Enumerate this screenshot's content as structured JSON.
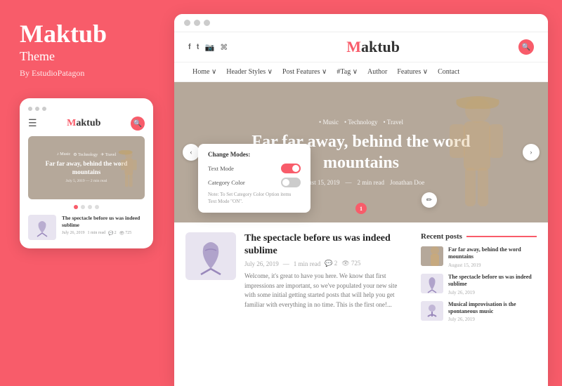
{
  "left": {
    "brand": "Maktub",
    "theme_label": "Theme",
    "by_label": "By EstudioPatagon",
    "mobile": {
      "brand": "Maktub",
      "hero_tags": [
        "Music",
        "Technology",
        "Travel"
      ],
      "hero_title": "Far far away, behind the word mountains",
      "hero_meta": "July 5, 2019  —  2 min read",
      "nav_dots": [
        "active",
        "",
        "",
        "",
        ""
      ],
      "post_title": "The spectacle before us was indeed sublime",
      "post_meta_date": "July 26, 2019",
      "post_meta_read": "1 min read",
      "post_meta_comments": "2",
      "post_meta_views": "725"
    }
  },
  "right": {
    "browser_circles": [
      "",
      "",
      ""
    ],
    "social_icons": [
      "f",
      "t",
      "in",
      "rss"
    ],
    "site_logo": "Maktub",
    "nav_items": [
      {
        "label": "Home",
        "has_chevron": true
      },
      {
        "label": "Header Styles",
        "has_chevron": true
      },
      {
        "label": "Post Features",
        "has_chevron": true
      },
      {
        "label": "#Tag",
        "has_chevron": true
      },
      {
        "label": "Author",
        "has_chevron": false
      },
      {
        "label": "Features",
        "has_chevron": true
      },
      {
        "label": "Contact",
        "has_chevron": false
      }
    ],
    "hero": {
      "tags": [
        "Music",
        "Technology",
        "Travel"
      ],
      "title": "Far far away, behind the word mountains",
      "date": "August 15, 2019",
      "read": "2 min read",
      "notify": "1",
      "author": "Jonathan Doe"
    },
    "change_modes": {
      "title": "Change Modes:",
      "text_mode_label": "Text Mode",
      "category_color_label": "Category Color",
      "note": "Note: To Set Category Color Option items Text Mode \"ON\"."
    },
    "post": {
      "title": "The spectacle before us was indeed sublime",
      "date": "July 26, 2019",
      "read": "1 min read",
      "comments": "2",
      "views": "725",
      "excerpt": "Welcome, it's great to have you here. We know that first impressions are important, so we've populated your new site with some initial getting started posts that will help you get familiar with everything in no time. This is the first one!..."
    },
    "recent_posts": {
      "header": "Recent posts",
      "items": [
        {
          "title": "Far far away, behind the word mountains",
          "date": "August 15, 2019"
        },
        {
          "title": "The spectacle before us was indeed sublime",
          "date": "July 26, 2019"
        },
        {
          "title": "Musical improvisation is the spontaneous music",
          "date": "July 26, 2019"
        }
      ]
    }
  }
}
